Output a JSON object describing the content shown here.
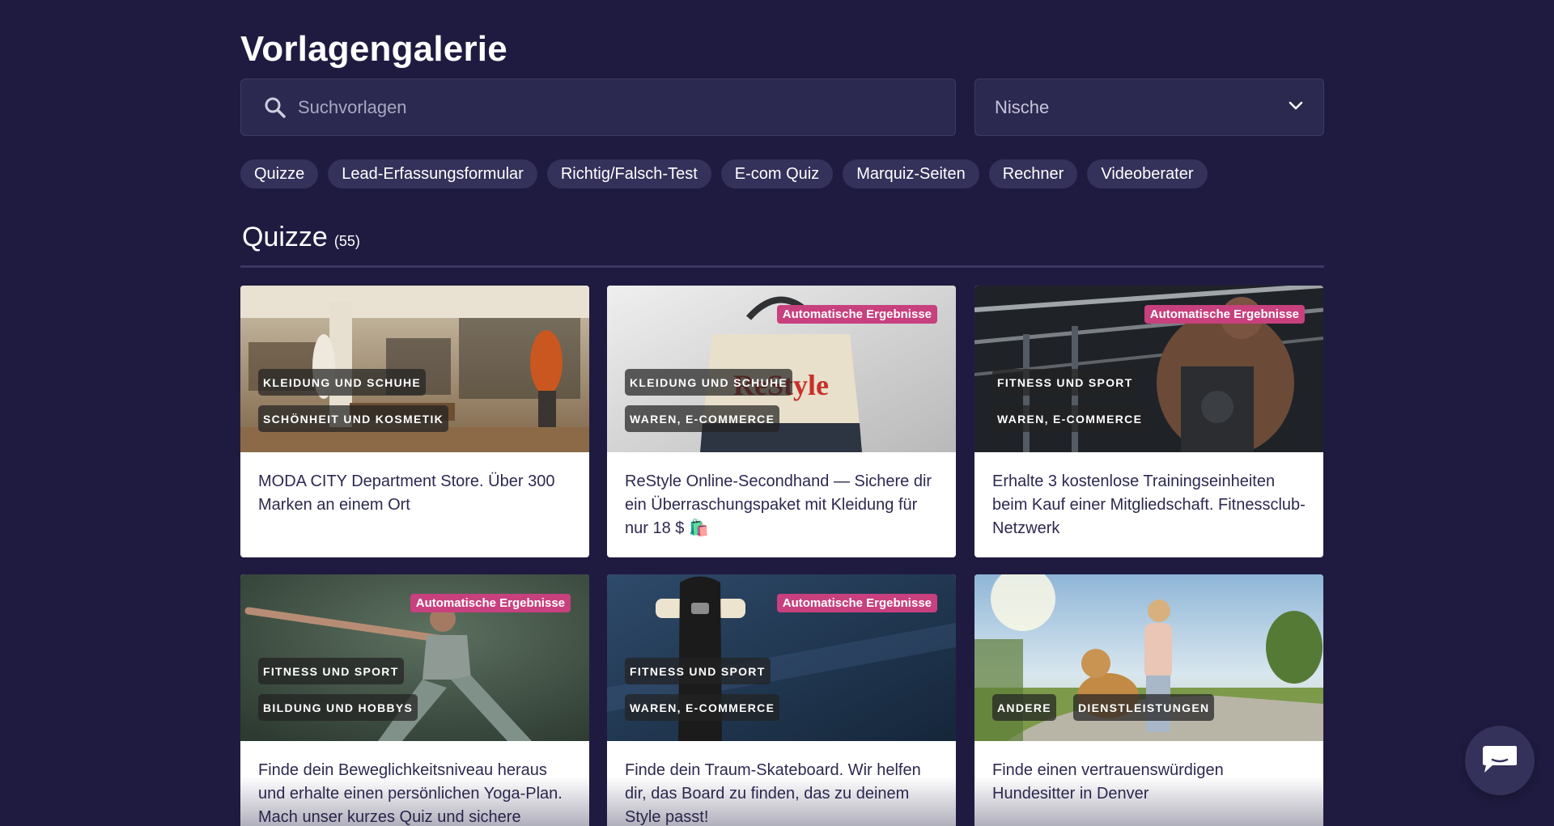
{
  "page": {
    "title": "Vorlagengalerie"
  },
  "search": {
    "placeholder": "Suchvorlagen",
    "icon": "search-icon"
  },
  "niche": {
    "value": "Nische",
    "icon": "chevron-down-icon"
  },
  "chips": [
    "Quizze",
    "Lead-Erfassungsformular",
    "Richtig/Falsch-Test",
    "E-com Quiz",
    "Marquiz-Seiten",
    "Rechner",
    "Videoberater"
  ],
  "section": {
    "name": "Quizze",
    "count": "(55)"
  },
  "cards": [
    {
      "badge": "",
      "tags": [
        "KLEIDUNG UND SCHUHE",
        "SCHÖNHEIT UND KOSMETIK"
      ],
      "title": "MODA CITY Department Store. Über 300 Marken an einem Ort",
      "image": "store"
    },
    {
      "badge": "Automatische Ergebnisse",
      "tags": [
        "KLEIDUNG UND SCHUHE",
        "WAREN, E-COMMERCE"
      ],
      "title": "ReStyle Online-Secondhand — Sichere dir ein Überraschungspaket mit Kleidung für nur 18 $ 🛍️",
      "image": "bag"
    },
    {
      "badge": "Automatische Ergebnisse",
      "tags": [
        "FITNESS UND SPORT",
        "WAREN, E-COMMERCE"
      ],
      "title": "Erhalte 3 kostenlose Trainingseinheiten beim Kauf einer Mitgliedschaft. Fitnessclub-Netzwerk",
      "image": "gym"
    },
    {
      "badge": "Automatische Ergebnisse",
      "tags": [
        "FITNESS UND SPORT",
        "BILDUNG UND HOBBYS"
      ],
      "title": "Finde dein Beweglichkeitsniveau heraus und erhalte einen persönlichen Yoga-Plan. Mach unser kurzes Quiz und sichere",
      "image": "yoga"
    },
    {
      "badge": "Automatische Ergebnisse",
      "tags": [
        "FITNESS UND SPORT",
        "WAREN, E-COMMERCE"
      ],
      "title": "Finde dein Traum-Skateboard. Wir helfen dir, das Board zu finden, das zu deinem Style passt!",
      "image": "skate"
    },
    {
      "badge": "",
      "tags": [
        "ANDERE",
        "DIENSTLEISTUNGEN"
      ],
      "title": "Finde einen vertrauenswürdigen Hundesitter in Denver",
      "image": "dog"
    }
  ],
  "chat": {
    "icon": "chat-icon"
  },
  "colors": {
    "background": "#1f1b40",
    "badge": "#c8407e",
    "chip": "#34315a",
    "input": "#2c2950"
  }
}
